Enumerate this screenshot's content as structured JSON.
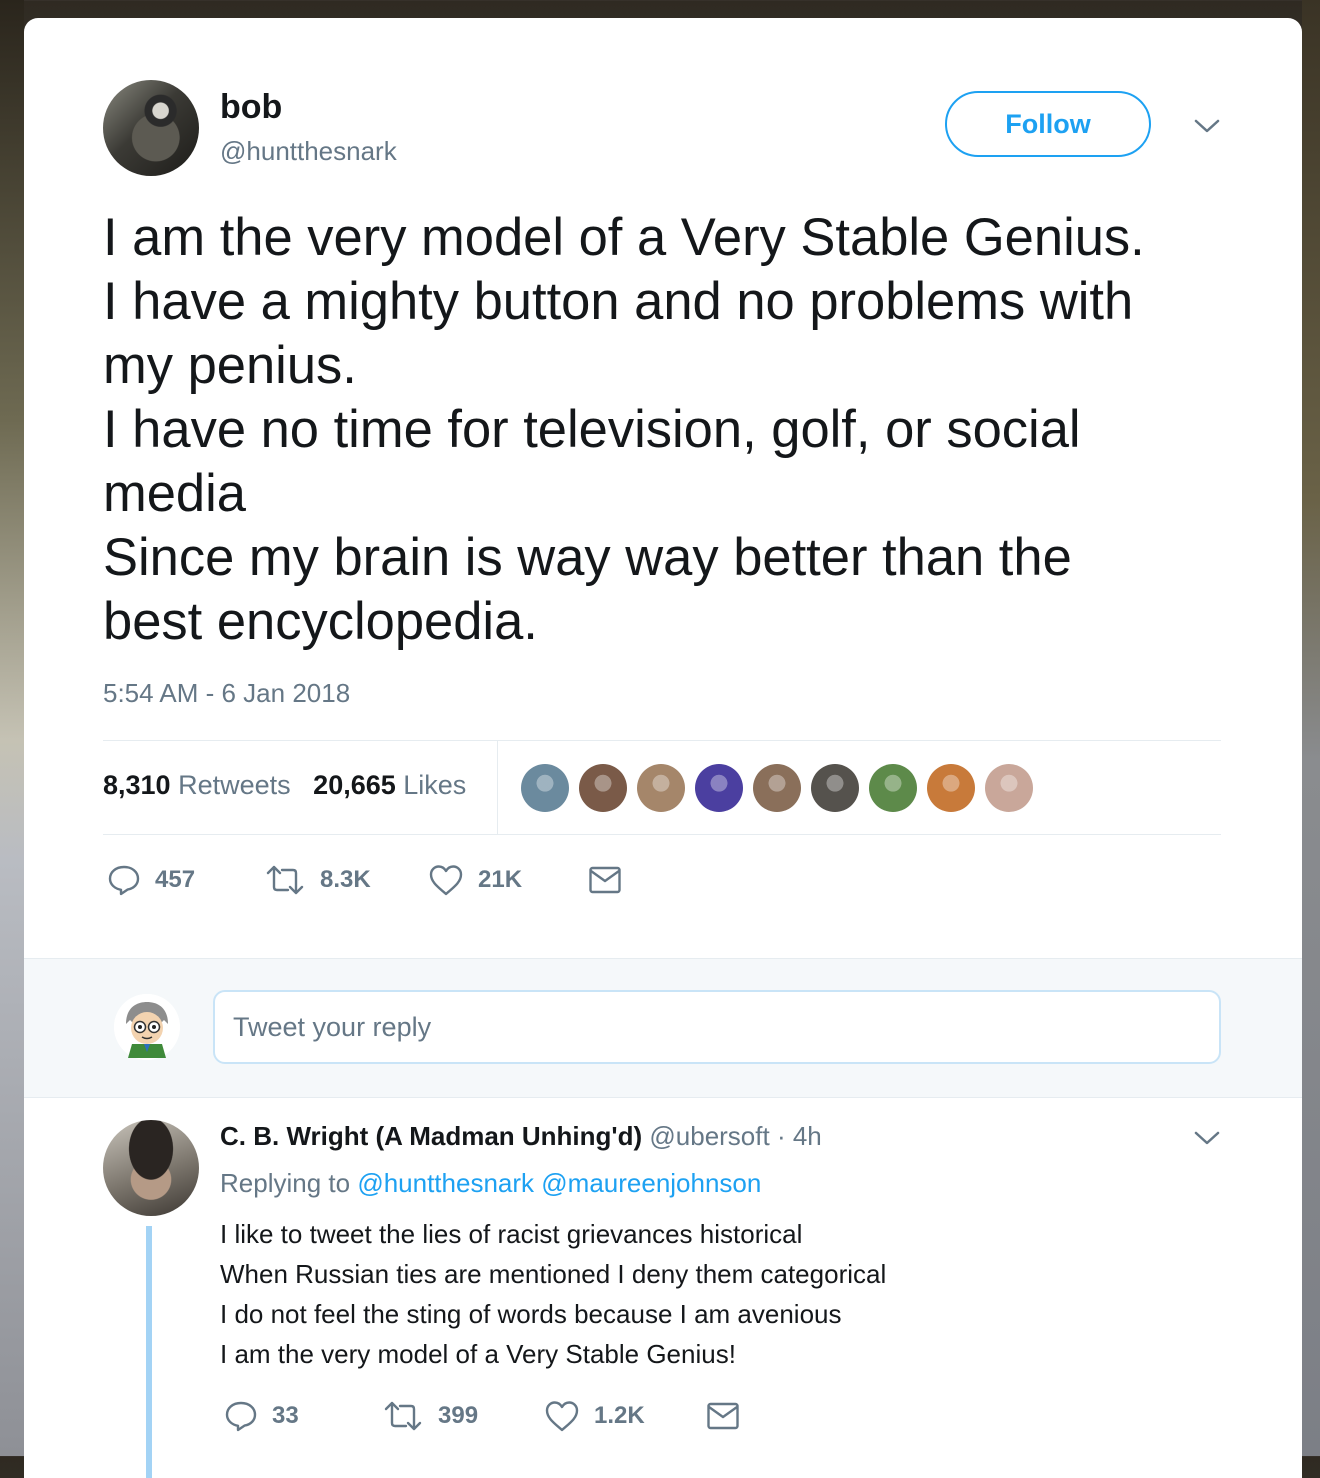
{
  "tweet": {
    "author_name": "bob",
    "author_handle": "@huntthesnark",
    "follow_label": "Follow",
    "text_lines": [
      "I am the very model of a Very Stable Genius.",
      "I have a mighty button and no problems with",
      "my penius.",
      "I have no time for television, golf, or social",
      "media",
      "Since my brain is way way better than the",
      "best encyclopedia."
    ],
    "timestamp": "5:54 AM - 6 Jan 2018",
    "retweets_count": "8,310",
    "retweets_label": "Retweets",
    "likes_count": "20,665",
    "likes_label": "Likes",
    "actions": {
      "replies": "457",
      "retweets": "8.3K",
      "likes": "21K"
    },
    "liker_avatar_colors": [
      "#6b8a9e",
      "#7a5a48",
      "#a5866a",
      "#4b3fa0",
      "#8a6f5a",
      "#55524d",
      "#5d8a4a",
      "#c87a3a",
      "#c9a79a"
    ]
  },
  "reply_box": {
    "placeholder": "Tweet your reply"
  },
  "reply": {
    "author_name": "C. B. Wright (A Madman Unhing'd)",
    "author_handle": "@ubersoft",
    "time": "· 4h",
    "replying_to_label": "Replying to",
    "mentions": [
      "@huntthesnark",
      "@maureenjohnson"
    ],
    "text_lines": [
      "I like to tweet the lies of racist grievances historical",
      "When Russian ties are mentioned I deny them categorical",
      "I do not feel the sting of words because I am avenious",
      "I am the very model of a Very Stable Genius!"
    ],
    "actions": {
      "replies": "33",
      "retweets": "399",
      "likes": "1.2K"
    }
  },
  "colors": {
    "accent": "#1da1f2",
    "text": "#14171a",
    "muted": "#657786",
    "thread_line": "#a3d3f5"
  }
}
